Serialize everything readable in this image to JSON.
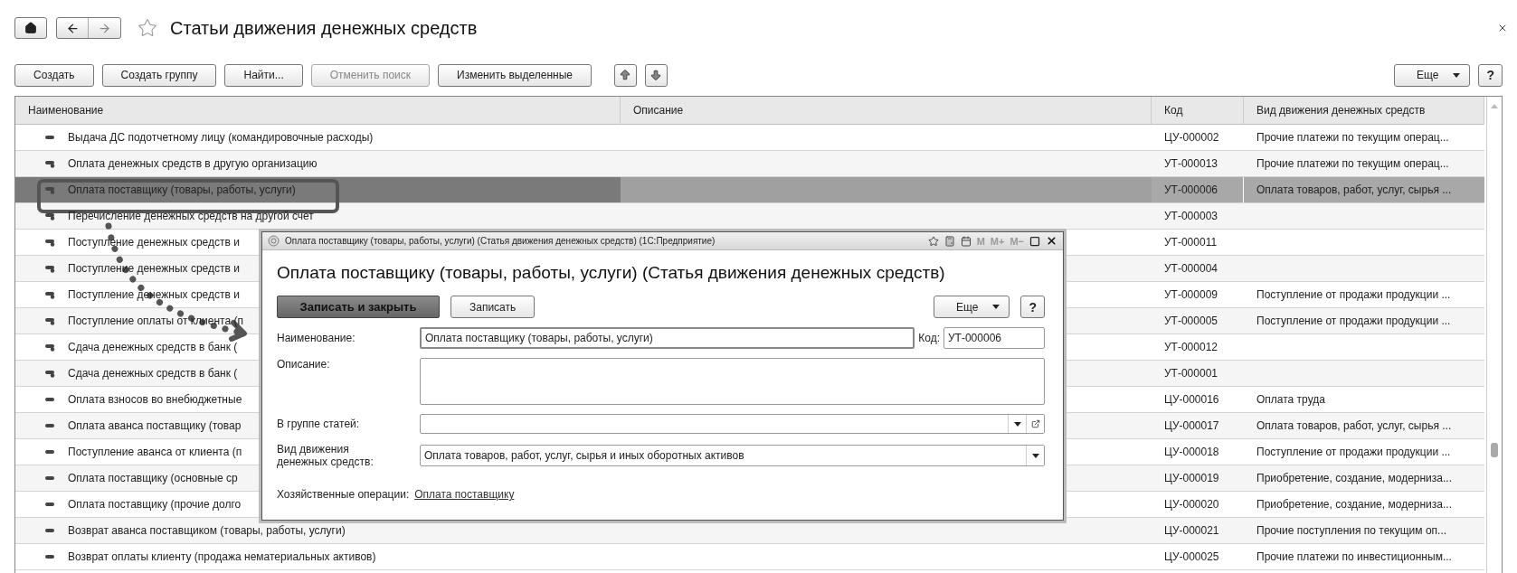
{
  "window": {
    "title": "Статьи движения денежных средств"
  },
  "toolbar": {
    "buttons": [
      {
        "label": "Создать",
        "disabled": false
      },
      {
        "label": "Создать группу",
        "disabled": false
      },
      {
        "label": "Найти...",
        "disabled": false
      },
      {
        "label": "Отменить поиск",
        "disabled": true
      },
      {
        "label": "Изменить выделенные",
        "disabled": false
      }
    ],
    "more": "Еще",
    "help": "?"
  },
  "table": {
    "columns": [
      "Наименование",
      "Описание",
      "Код",
      "Вид движения денежных средств"
    ],
    "rows": [
      {
        "kind": "plain",
        "name": "Выдача ДС подотчетному лицу (командировочные расходы)",
        "code": "ЦУ-000002",
        "flow": "Прочие платежи по текущим операц...",
        "selected": false
      },
      {
        "kind": "linked",
        "name": "Оплата денежных средств в другую организацию",
        "code": "УТ-000013",
        "flow": "Прочие платежи по текущим операц...",
        "selected": false
      },
      {
        "kind": "linked",
        "name": "Оплата поставщику (товары, работы, услуги)",
        "code": "УТ-000006",
        "flow": "Оплата товаров, работ, услуг, сырья ...",
        "selected": true
      },
      {
        "kind": "linked",
        "name": "Перечисление денежных средств на другой счет",
        "code": "УТ-000003",
        "selected": false
      },
      {
        "kind": "linked",
        "name": "Поступление денежных средств и",
        "code": "УТ-000011",
        "selected": false
      },
      {
        "kind": "linked",
        "name": "Поступление денежных средств и",
        "code": "УТ-000004",
        "selected": false
      },
      {
        "kind": "linked",
        "name": "Поступление денежных средств и",
        "code": "УТ-000009",
        "flow": "Поступление от продажи продукции ...",
        "selected": false
      },
      {
        "kind": "linked",
        "name": "Поступление оплаты от клиента (п",
        "code": "УТ-000005",
        "flow": "Поступление от продажи продукции ...",
        "selected": false
      },
      {
        "kind": "linked",
        "name": "Сдача денежных средств в банк (",
        "code": "УТ-000012",
        "selected": false
      },
      {
        "kind": "linked",
        "name": "Сдача денежных средств в банк (",
        "code": "УТ-000001",
        "selected": false
      },
      {
        "kind": "plain",
        "name": "Оплата взносов во внебюджетные",
        "code": "ЦУ-000016",
        "flow": "Оплата труда",
        "selected": false
      },
      {
        "kind": "plain",
        "name": "Оплата аванса поставщику (товар",
        "code": "ЦУ-000017",
        "flow": "Оплата товаров, работ, услуг, сырья ...",
        "selected": false
      },
      {
        "kind": "plain",
        "name": "Поступление аванса от клиента (п",
        "code": "ЦУ-000018",
        "flow": "Поступление от продажи продукции ...",
        "selected": false
      },
      {
        "kind": "plain",
        "name": "Оплата поставщику (основные ср",
        "code": "ЦУ-000019",
        "flow": "Приобретение, создание, модерниза...",
        "selected": false
      },
      {
        "kind": "plain",
        "name": "Оплата поставщику (прочие долго",
        "code": "ЦУ-000020",
        "flow": "Приобретение, создание, модерниза...",
        "selected": false
      },
      {
        "kind": "plain",
        "name": "Возврат аванса поставщиком (товары, работы, услуги)",
        "code": "ЦУ-000021",
        "flow": "Прочие поступления по текущим оп...",
        "selected": false
      },
      {
        "kind": "plain",
        "name": "Возврат оплаты клиенту (продажа нематериальных активов)",
        "code": "ЦУ-000025",
        "flow": "Прочие платежи по инвестиционным...",
        "selected": false
      }
    ]
  },
  "dialog": {
    "window_title": "Оплата поставщику (товары, работы, услуги) (Статья движения денежных средств)  (1С:Предприятие)",
    "memory_buttons": [
      "M",
      "M+",
      "M−"
    ],
    "heading": "Оплата поставщику (товары, работы, услуги) (Статья движения денежных средств)",
    "save_close": "Записать и закрыть",
    "save": "Записать",
    "more": "Еще",
    "help": "?",
    "name_label": "Наименование:",
    "name_value": "Оплата поставщику (товары, работы, услуги)",
    "code_label": "Код:",
    "code_value": "УТ-000006",
    "description_label": "Описание:",
    "group_label": "В группе статей:",
    "flow_label": "Вид движения денежных средств:",
    "flow_value": "Оплата товаров, работ, услуг, сырья и иных оборотных активов",
    "operations_label": "Хозяйственные операции:",
    "operations_link": "Оплата поставщику"
  }
}
